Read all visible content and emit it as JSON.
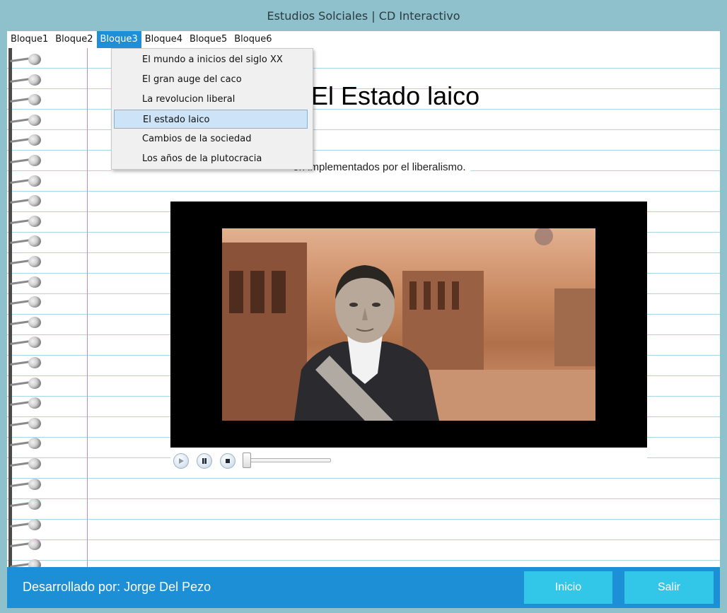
{
  "window": {
    "title": "Estudios Solciales | CD Interactivo"
  },
  "menubar": {
    "items": [
      {
        "label": "Bloque1"
      },
      {
        "label": "Bloque2"
      },
      {
        "label": "Bloque3"
      },
      {
        "label": "Bloque4"
      },
      {
        "label": "Bloque5"
      },
      {
        "label": "Bloque6"
      }
    ],
    "active": "Bloque3"
  },
  "dropdown": {
    "items": [
      {
        "label": "El mundo a inicios del siglo XX"
      },
      {
        "label": "El gran auge del caco"
      },
      {
        "label": "La revolucion liberal"
      },
      {
        "label": "El estado laico"
      },
      {
        "label": "Cambios de la sociedad"
      },
      {
        "label": "Los años de la plutocracia"
      }
    ],
    "highlighted": "El estado laico"
  },
  "main": {
    "title": "El Estado laico",
    "objective_visible": "ón implementados por el liberalismo."
  },
  "player": {
    "buttons": [
      {
        "icon": "play-icon"
      },
      {
        "icon": "pause-icon"
      },
      {
        "icon": "stop-icon"
      }
    ],
    "progress": 0
  },
  "footer": {
    "credit": "Desarrollado por: Jorge Del Pezo",
    "buttons": {
      "inicio": "Inicio",
      "salir": "Salir"
    }
  },
  "colors": {
    "frame": "#8fc1cc",
    "accent": "#1d8fd6",
    "footer_button": "#32c6e8",
    "menu_active": "#1e8fd6",
    "ruled_line": "#a9d6e6",
    "margin_line": "#c08ac8"
  }
}
